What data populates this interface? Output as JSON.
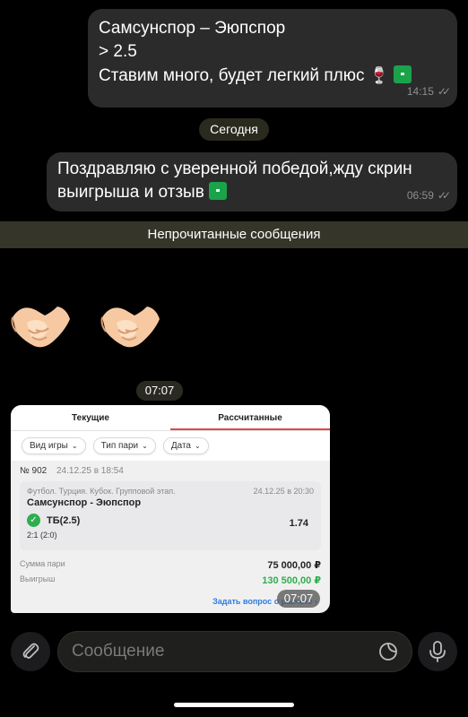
{
  "messages": [
    {
      "text": "Самсунспор – Эюпспор\n> 2.5\nСтавим много, будет легкий плюс",
      "time": "14:15"
    },
    {
      "text": "Поздравляю с уверенной победой,жду скрин\nвыигрыша и отзыв",
      "time": "06:59"
    }
  ],
  "date_divider": "Сегодня",
  "unread_label": "Непрочитанные сообщения",
  "sticker_time": "07:07",
  "screenshot": {
    "tabs": [
      "Текущие",
      "Рассчитанные"
    ],
    "filters": [
      "Вид игры",
      "Тип пари",
      "Дата"
    ],
    "ticket_no": "№ 902",
    "ticket_date": "24.12.25 в 18:54",
    "league": "Футбол. Турция. Кубок. Групповой этап.",
    "event_date": "24.12.25 в 20:30",
    "teams": "Самсунспор - Эюпспор",
    "pick": "ТБ(2.5)",
    "odd": "1.74",
    "score": "2:1 (2:0)",
    "stake_label": "Сумма пари",
    "stake_value": "75 000,00 ₽",
    "win_label": "Выигрыш",
    "win_value": "130 500,00 ₽",
    "ask_link": "Задать вопрос о расчете",
    "time": "07:07"
  },
  "input": {
    "placeholder": "Сообщение"
  },
  "colors": {
    "accent_green": "#2fae4e",
    "active_tab_underline": "#e04848",
    "link_blue": "#2c7be5"
  }
}
